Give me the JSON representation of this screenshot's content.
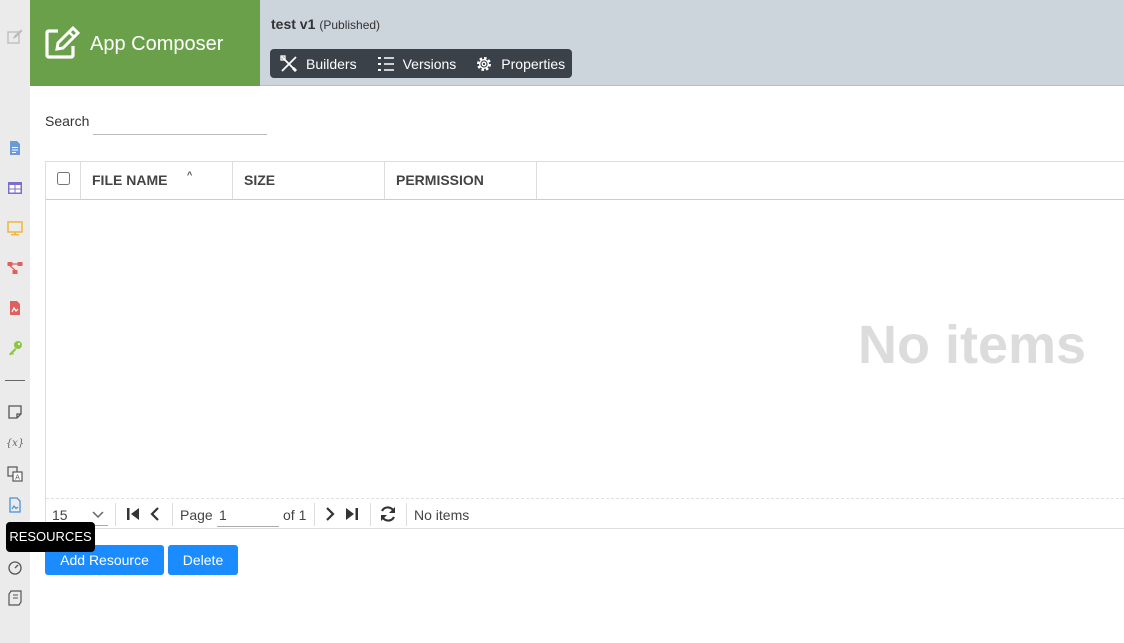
{
  "brand": {
    "name": "App Composer"
  },
  "app": {
    "name": "test v1",
    "status": "(Published)"
  },
  "toolbar": {
    "builders": "Builders",
    "versions": "Versions",
    "properties": "Properties"
  },
  "search": {
    "label": "Search",
    "value": ""
  },
  "table": {
    "columns": [
      "FILE NAME",
      "SIZE",
      "PERMISSION"
    ],
    "rows": [],
    "empty_text": "No items"
  },
  "pager": {
    "page_size": "15",
    "page_label": "Page",
    "page_value": "1",
    "of_label": "of 1",
    "status": "No items"
  },
  "actions": {
    "add": "Add Resource",
    "delete": "Delete"
  },
  "tooltip": "RESOURCES",
  "colors": {
    "brand": "#6aa04a",
    "header": "#ccd4dc",
    "toolbar": "#3b4148",
    "primary": "#1a8cff",
    "sidebar": "#ebebeb"
  },
  "sidebar_icons": [
    "edit-icon",
    "document-icon",
    "table-icon",
    "monitor-icon",
    "workflow-icon",
    "report-icon",
    "key-icon",
    "note-icon",
    "variable-icon",
    "translate-icon",
    "resources-icon",
    "gauge-icon",
    "script-icon"
  ]
}
